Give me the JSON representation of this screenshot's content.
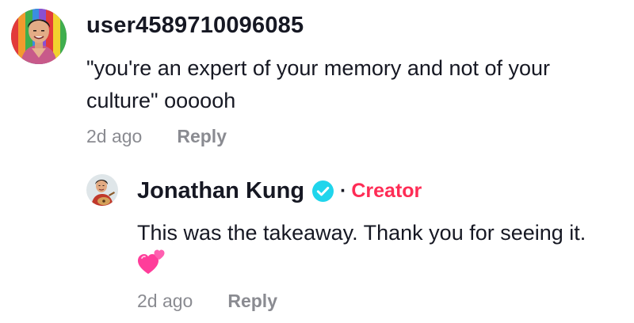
{
  "comment": {
    "username": "user4589710096085",
    "text": "\"you're an expert of your memory and not of your culture\" oooooh",
    "timestamp": "2d ago",
    "reply_label": "Reply",
    "avatar_icon": "user-avatar-photo"
  },
  "reply": {
    "username": "Jonathan Kung",
    "verified_icon": "verified-badge-icon",
    "separator": "·",
    "creator_label": "Creator",
    "text": "This was the takeaway. Thank you for seeing it.",
    "emoji_icon": "two-hearts-icon",
    "timestamp": "2d ago",
    "reply_label": "Reply",
    "avatar_icon": "creator-avatar-photo"
  },
  "colors": {
    "text_primary": "#161823",
    "text_secondary": "#8a8b91",
    "creator_accent": "#fe2c55",
    "verified_blue": "#20d5ec"
  }
}
